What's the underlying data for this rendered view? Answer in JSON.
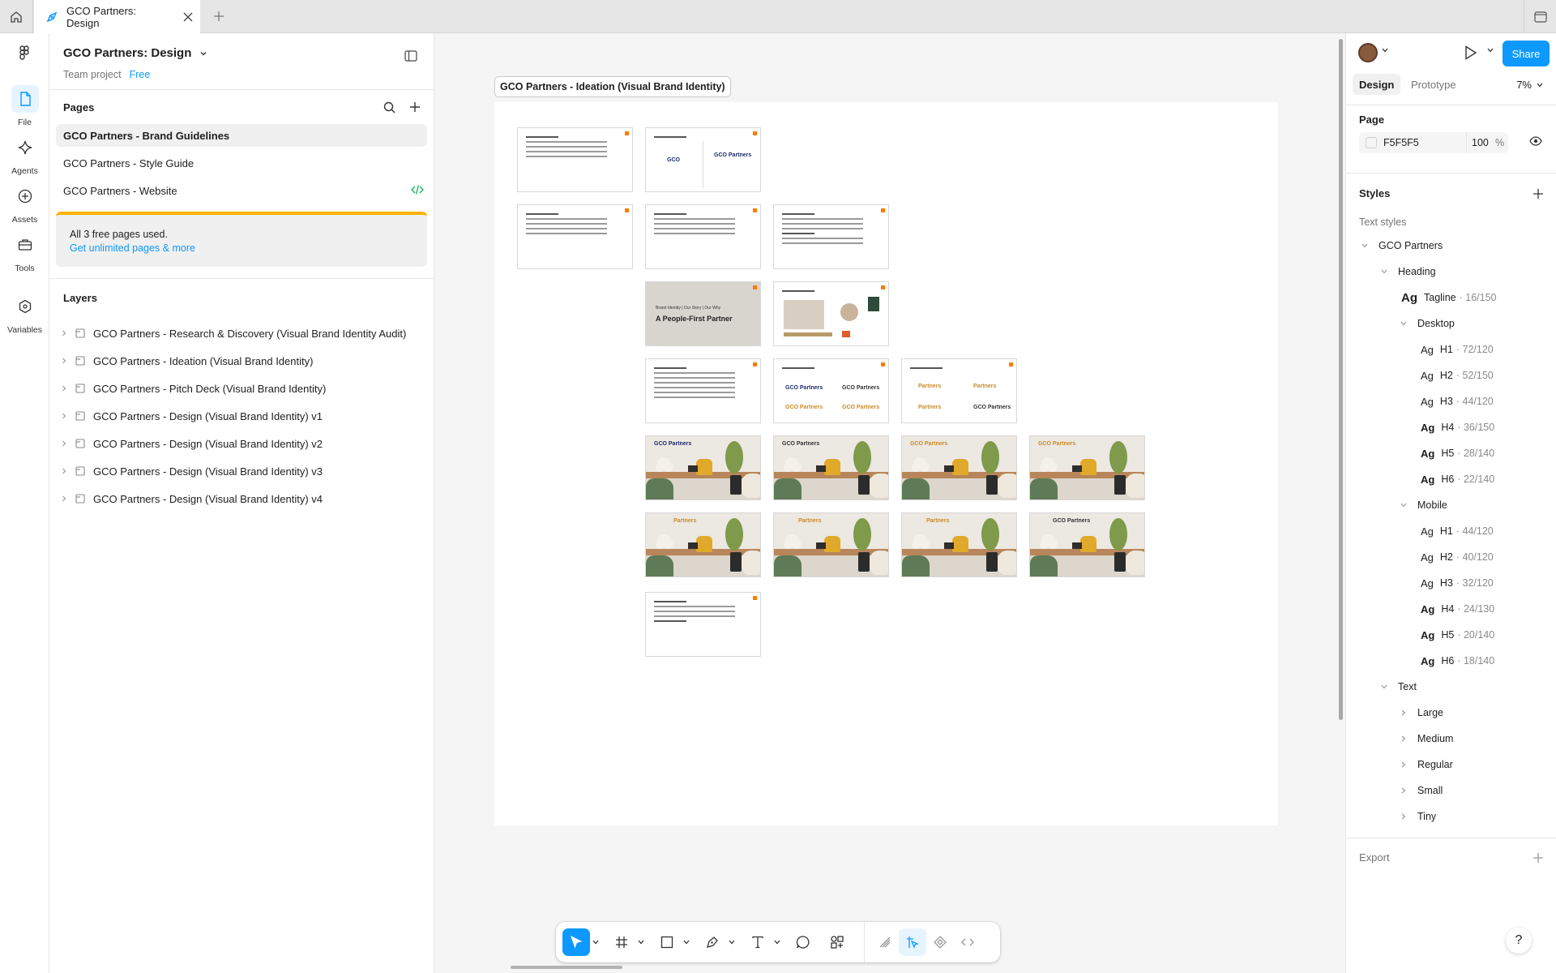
{
  "tabs": {
    "active_title": "GCO Partners: Design"
  },
  "rail": {
    "items": [
      {
        "label": "File"
      },
      {
        "label": "Agents"
      },
      {
        "label": "Assets"
      },
      {
        "label": "Tools"
      },
      {
        "label": "Variables"
      }
    ]
  },
  "file": {
    "name": "GCO Partners: Design",
    "team": "Team project",
    "plan": "Free"
  },
  "pages": {
    "title": "Pages",
    "items": [
      {
        "label": "GCO Partners - Brand Guidelines",
        "selected": true
      },
      {
        "label": "GCO Partners - Style Guide"
      },
      {
        "label": "GCO Partners - Website"
      }
    ],
    "upgrade_text": "All 3 free pages used.",
    "upgrade_link": "Get unlimited pages & more"
  },
  "layers": {
    "title": "Layers",
    "items": [
      {
        "label": "GCO Partners - Research & Discovery (Visual Brand Identity Audit)"
      },
      {
        "label": "GCO Partners - Ideation (Visual Brand Identity)"
      },
      {
        "label": "GCO Partners - Pitch Deck (Visual Brand Identity)"
      },
      {
        "label": "GCO Partners - Design (Visual Brand Identity) v1"
      },
      {
        "label": "GCO Partners - Design (Visual Brand Identity) v2"
      },
      {
        "label": "GCO Partners - Design (Visual Brand Identity) v3"
      },
      {
        "label": "GCO Partners - Design (Visual Brand Identity) v4"
      }
    ]
  },
  "canvas": {
    "section_label": "GCO Partners - Ideation (Visual Brand Identity)",
    "thumb_gray_small": "Brand Identity | Our Story | Our Why",
    "thumb_gray_title": "A People-First Partner",
    "logo_text": "GCO Partners",
    "photo_label": "GCO Partners",
    "photo_label_alt": "Partners"
  },
  "right": {
    "share": "Share",
    "tabs": [
      "Design",
      "Prototype"
    ],
    "zoom": "7%",
    "page_title": "Page",
    "page_fill_hex": "F5F5F5",
    "page_fill_opacity": "100",
    "page_fill_unit": "%",
    "styles_title": "Styles",
    "text_styles_title": "Text styles",
    "group": "GCO Partners",
    "heading": "Heading",
    "tagline": {
      "ag": "Ag",
      "name": "Tagline",
      "meta": "· 16/150"
    },
    "desktop": "Desktop",
    "desktop_items": [
      {
        "ag": "Ag",
        "name": "H1",
        "meta": "· 72/120"
      },
      {
        "ag": "Ag",
        "name": "H2",
        "meta": "· 52/150"
      },
      {
        "ag": "Ag",
        "name": "H3",
        "meta": "· 44/120"
      },
      {
        "ag": "Ag",
        "name": "H4",
        "meta": "· 36/150"
      },
      {
        "ag": "Ag",
        "name": "H5",
        "meta": "· 28/140"
      },
      {
        "ag": "Ag",
        "name": "H6",
        "meta": "· 22/140"
      }
    ],
    "mobile": "Mobile",
    "mobile_items": [
      {
        "ag": "Ag",
        "name": "H1",
        "meta": "· 44/120"
      },
      {
        "ag": "Ag",
        "name": "H2",
        "meta": "· 40/120"
      },
      {
        "ag": "Ag",
        "name": "H3",
        "meta": "· 32/120"
      },
      {
        "ag": "Ag",
        "name": "H4",
        "meta": "· 24/130"
      },
      {
        "ag": "Ag",
        "name": "H5",
        "meta": "· 20/140"
      },
      {
        "ag": "Ag",
        "name": "H6",
        "meta": "· 18/140"
      }
    ],
    "text": "Text",
    "text_items": [
      "Large",
      "Medium",
      "Regular",
      "Small",
      "Tiny"
    ],
    "export": "Export"
  },
  "help": "?",
  "colors": {
    "accent": "#0d99ff",
    "warning": "#ffb100",
    "canvas": "#f5f5f5",
    "brand_orange": "#ff7a00",
    "brand_navy": "#1f2a6b"
  }
}
